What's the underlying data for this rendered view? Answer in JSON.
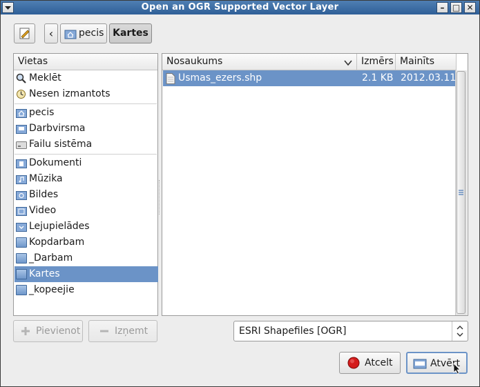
{
  "window": {
    "title": "Open an OGR Supported Vector Layer"
  },
  "titlebar_buttons": {
    "close": "✕",
    "minimize": "–",
    "maximize": "□"
  },
  "pathbar": {
    "back": "‹",
    "crumbs": [
      "pecis",
      "Kartes"
    ]
  },
  "places": {
    "header": "Vietas",
    "groups": [
      [
        "Meklēt",
        "Nesen izmantots"
      ],
      [
        "pecis",
        "Darbvirsma",
        "Failu sistēma"
      ],
      [
        "Dokumenti",
        "Mūzika",
        "Bildes",
        "Video",
        "Lejupielādes",
        "Kopdarbam",
        "_Darbam",
        "Kartes",
        "_kopeejie"
      ]
    ],
    "selected": "Kartes"
  },
  "files": {
    "col_name": "Nosaukums",
    "col_size": "Izmērs",
    "col_modified": "Mainīts",
    "rows": [
      {
        "name": "Usmas_ezers.shp",
        "size": "2.1 KB",
        "modified": "2012.03.11."
      }
    ]
  },
  "buttons": {
    "add": "Pievienot",
    "remove": "Izņemt",
    "cancel": "Atcelt",
    "open": "Atvērt"
  },
  "filter": {
    "selected": "ESRI Shapefiles [OGR]"
  },
  "colors": {
    "selection": "#6b93c7",
    "titlebar": "#3a6aa4",
    "cancel_icon": "#d41c1c"
  }
}
